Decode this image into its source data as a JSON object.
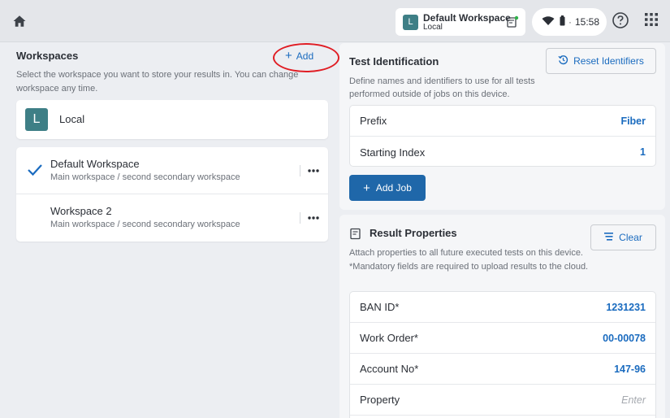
{
  "topbar": {
    "workspace_chip": {
      "avatar": "L",
      "title": "Default Workspace",
      "subtitle": "Local"
    },
    "status": {
      "time": "15:58",
      "separator": "·"
    }
  },
  "icons": {
    "home": "home-icon",
    "job": "job-icon",
    "wifi": "wifi-icon",
    "battery": "battery-icon",
    "help": "help-icon",
    "apps": "apps-grid-icon",
    "check": "check-icon",
    "more": "more-horizontal-icon",
    "history": "history-icon",
    "clear": "clear-icon"
  },
  "colors": {
    "accent": "#1a6bbf",
    "primary_button": "#1f67a9",
    "avatar": "#3e7f86",
    "annotation": "#e01d24"
  },
  "workspaces": {
    "title": "Workspaces",
    "add_label": "Add",
    "description": "Select the workspace you want to store your results in. You can change workspace any time.",
    "local": {
      "avatar": "L",
      "label": "Local"
    },
    "items": [
      {
        "title": "Default Workspace",
        "path": "Main workspace / second secondary workspace",
        "selected": true
      },
      {
        "title": "Workspace 2",
        "path": "Main workspace / second secondary workspace",
        "selected": false
      }
    ]
  },
  "test_identification": {
    "title": "Test Identification",
    "reset_label": "Reset Identifiers",
    "description": "Define names and identifiers to use for all tests performed outside of jobs on this device.",
    "rows": [
      {
        "label": "Prefix",
        "value": "Fiber"
      },
      {
        "label": "Starting Index",
        "value": "1"
      }
    ],
    "add_job_label": "Add Job"
  },
  "result_properties": {
    "title": "Result Properties",
    "clear_label": "Clear",
    "description": "Attach properties to all future executed tests on this device. *Mandatory fields are required to upload results to the cloud.",
    "rows": [
      {
        "label": "BAN ID*",
        "value": "1231231"
      },
      {
        "label": "Work Order*",
        "value": "00-00078"
      },
      {
        "label": "Account No*",
        "value": "147-96"
      },
      {
        "label": "Property",
        "placeholder": "Enter"
      }
    ]
  }
}
